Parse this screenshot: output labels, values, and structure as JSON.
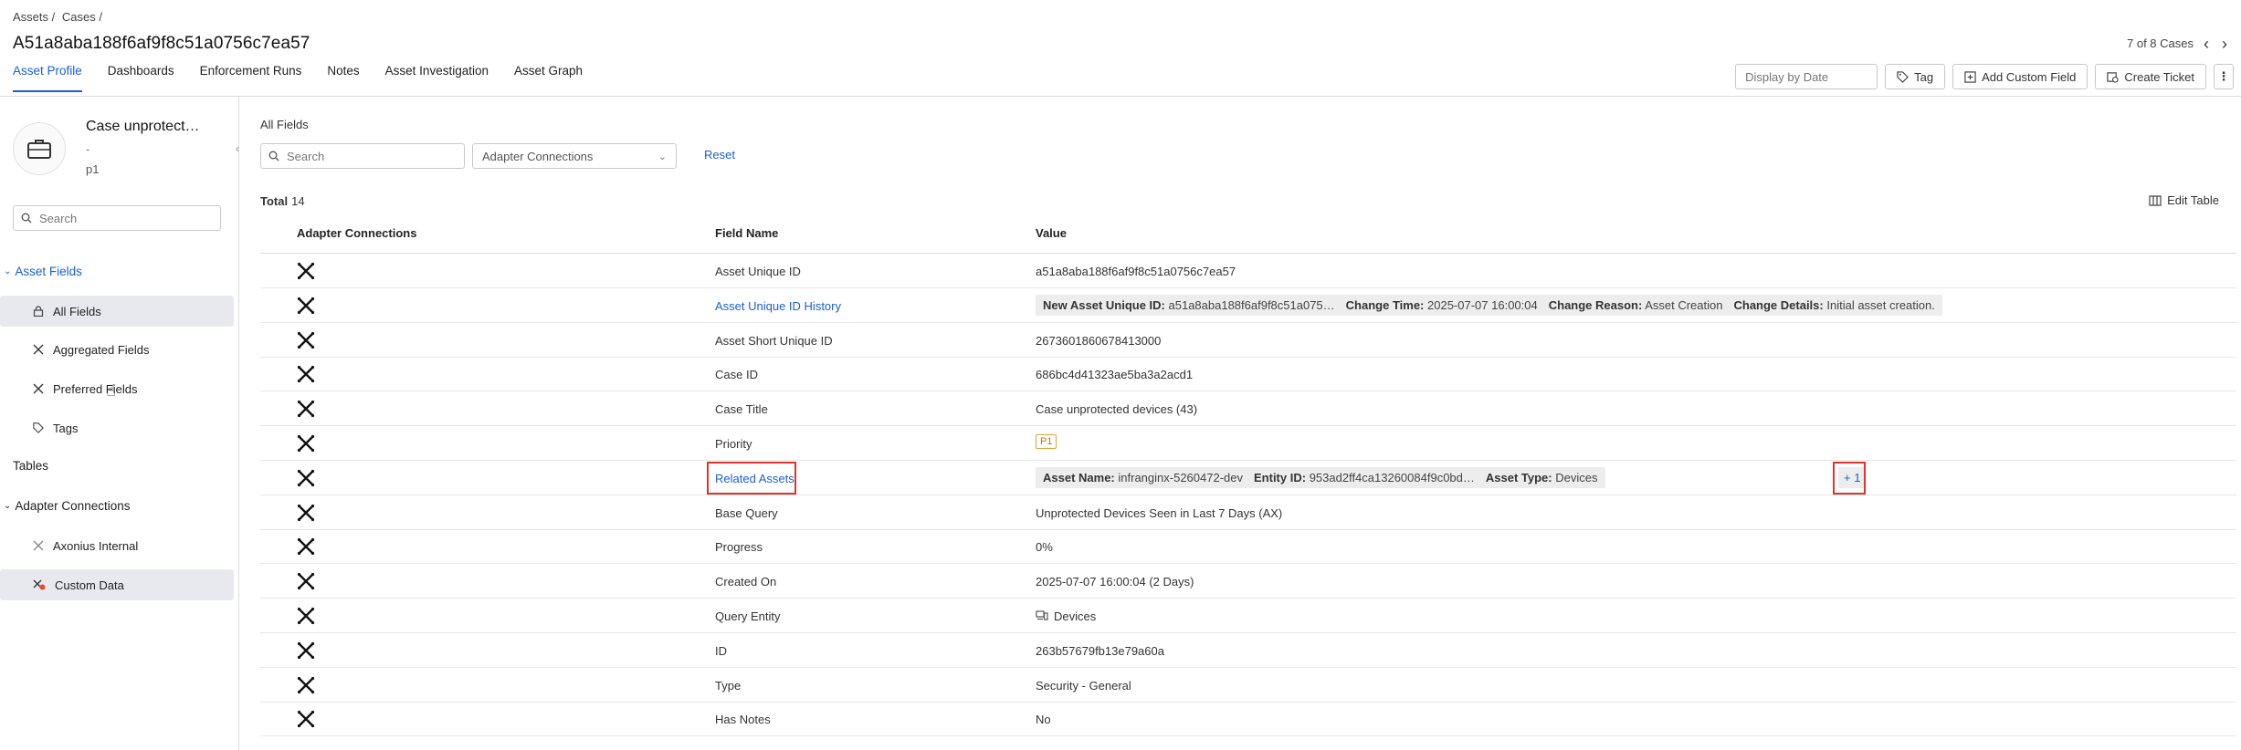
{
  "breadcrumb": [
    "Assets /",
    "Cases /"
  ],
  "page_title": "A51a8aba188f6af9f8c51a0756c7ea57",
  "pager": {
    "text": "7 of 8 Cases"
  },
  "tabs": [
    "Asset Profile",
    "Dashboards",
    "Enforcement Runs",
    "Notes",
    "Asset Investigation",
    "Asset Graph"
  ],
  "toolbar": {
    "display_by_date_placeholder": "Display by Date",
    "tag_label": "Tag",
    "add_custom_field_label": "Add Custom Field",
    "create_ticket_label": "Create Ticket"
  },
  "sidebar": {
    "asset_name": "Case unprotect…",
    "asset_dash": "-",
    "asset_priority": "p1",
    "search_placeholder": "Search",
    "asset_fields_section": "Asset Fields",
    "asset_fields_items": [
      "All Fields",
      "Aggregated Fields",
      "Preferred Fields",
      "Tags"
    ],
    "tables_section": "Tables",
    "adapter_section": "Adapter Connections",
    "adapter_items": [
      "Axonius Internal",
      "Custom Data"
    ]
  },
  "main": {
    "title": "All Fields",
    "search_placeholder": "Search",
    "adapter_select": "Adapter Connections",
    "reset_label": "Reset",
    "total_label": "Total",
    "total_count": "14",
    "edit_table_label": "Edit Table",
    "columns": [
      "Adapter Connections",
      "Field Name",
      "Value"
    ]
  },
  "rows": [
    {
      "field": "Asset Unique ID",
      "value": "a51a8aba188f6af9f8c51a0756c7ea57"
    },
    {
      "field": "Asset Unique ID History",
      "chips": [
        {
          "k": "New Asset Unique ID:",
          "v": "a51a8aba188f6af9f8c51a075…"
        },
        {
          "k": "Change Time:",
          "v": "2025-07-07 16:00:04"
        },
        {
          "k": "Change Reason:",
          "v": "Asset Creation"
        },
        {
          "k": "Change Details:",
          "v": "Initial asset creation."
        }
      ]
    },
    {
      "field": "Asset Short Unique ID",
      "value": "2673601860678413000"
    },
    {
      "field": "Case ID",
      "value": "686bc4d41323ae5ba3a2acd1"
    },
    {
      "field": "Case Title",
      "value": "Case unprotected devices (43)"
    },
    {
      "field": "Priority",
      "value": "P1"
    },
    {
      "field": "Related Assets",
      "chips": [
        {
          "k": "Asset Name:",
          "v": "infranginx-5260472-dev"
        },
        {
          "k": "Entity ID:",
          "v": "953ad2ff4ca13260084f9c0bd…"
        },
        {
          "k": "Asset Type:",
          "v": "Devices"
        }
      ],
      "more": "+ 1"
    },
    {
      "field": "Base Query",
      "value": "Unprotected Devices Seen in Last 7 Days (AX)"
    },
    {
      "field": "Progress",
      "value": "0%"
    },
    {
      "field": "Created On",
      "value": "2025-07-07 16:00:04 (2 Days)"
    },
    {
      "field": "Query Entity",
      "value": "Devices"
    },
    {
      "field": "ID",
      "value": "263b57679fb13e79a60a"
    },
    {
      "field": "Type",
      "value": "Security - General"
    },
    {
      "field": "Has Notes",
      "value": "No"
    }
  ]
}
